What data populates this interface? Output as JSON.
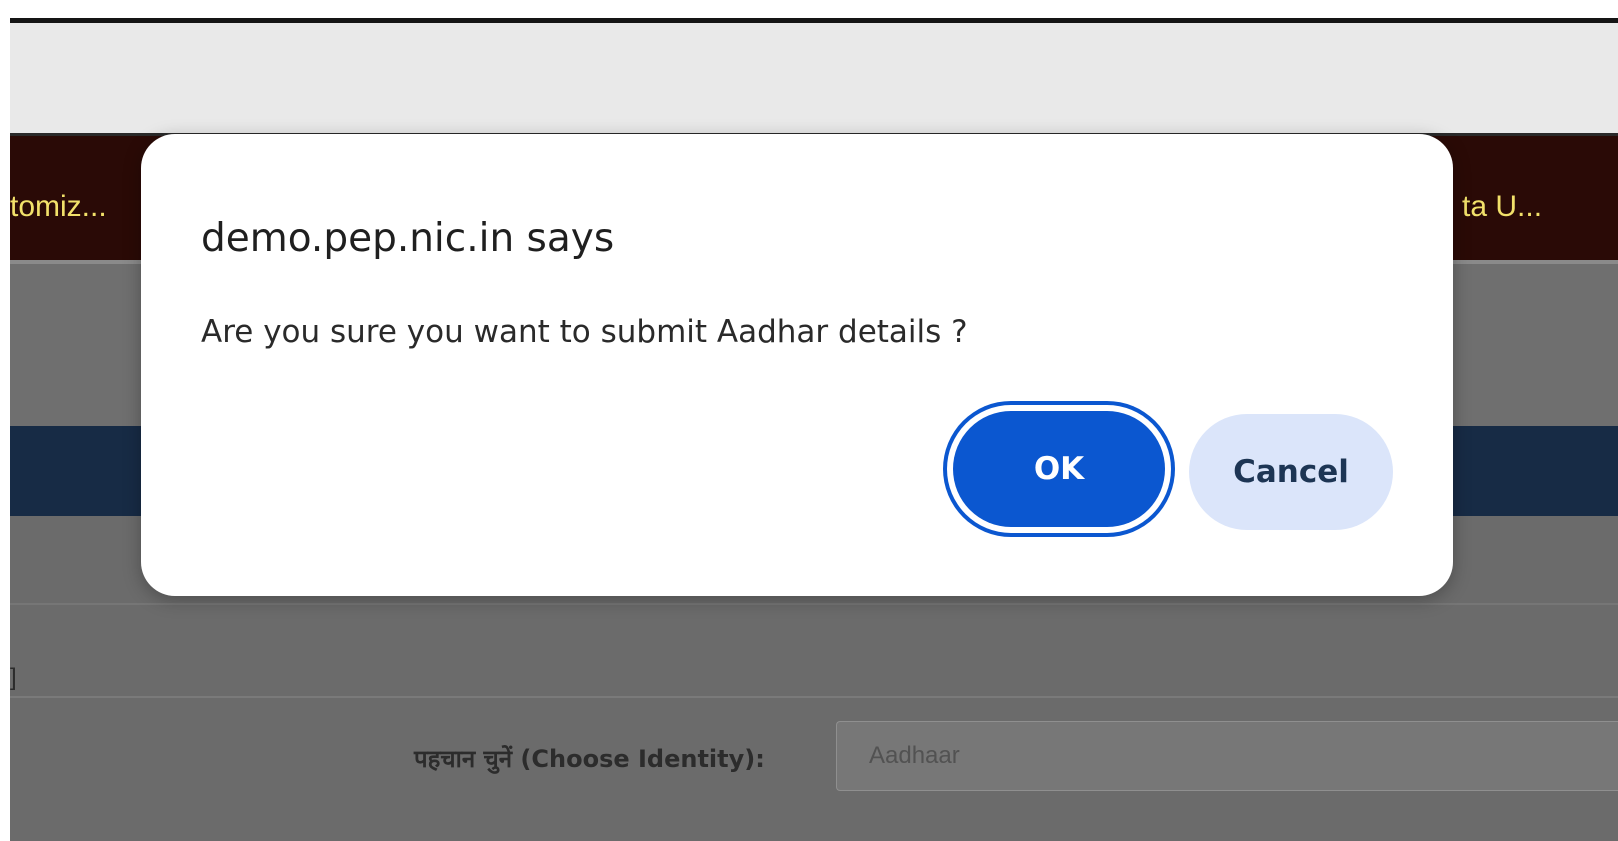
{
  "page": {
    "nav_left_label": "tomiz...",
    "nav_right_label": "ta U...",
    "left_fragment": "]",
    "identity_label": "पहचान चुनें (Choose Identity):",
    "identity_value": "Aadhaar"
  },
  "dialog": {
    "title": "demo.pep.nic.in says",
    "message": "Are you sure you want to submit Aadhar details ?",
    "ok_label": "OK",
    "cancel_label": "Cancel"
  },
  "colors": {
    "ok_button": "#0b57d0",
    "cancel_button": "#dbe5fa",
    "nav_background": "#2a0a06",
    "nav_text": "#f2e16a",
    "band_blue": "#172b45",
    "overlay_gray": "#6f6f6f"
  }
}
